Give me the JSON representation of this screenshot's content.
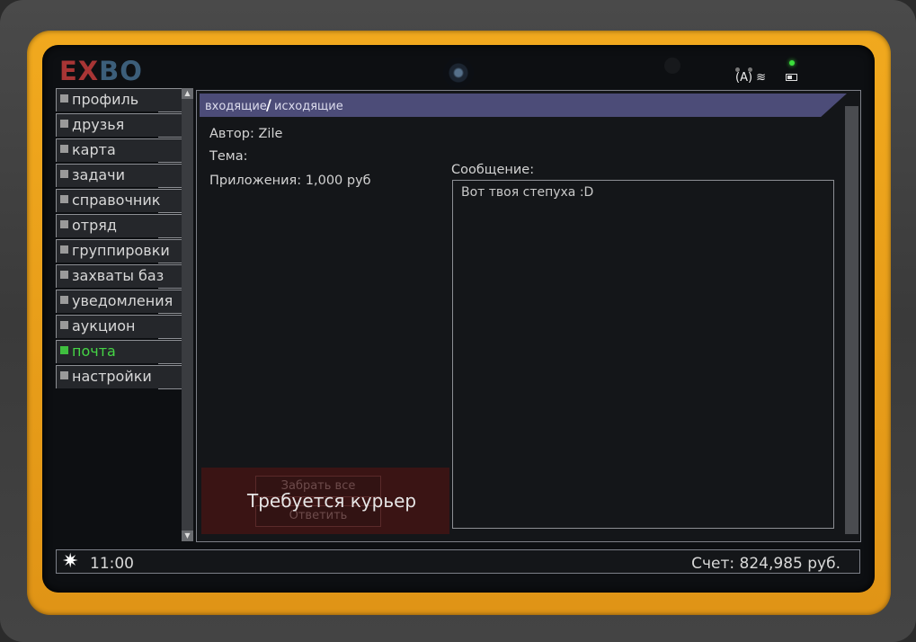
{
  "device": {
    "logo_part1": "EX",
    "logo_part2": "BO"
  },
  "nav": {
    "items": [
      {
        "label": "профиль",
        "active": false
      },
      {
        "label": "друзья",
        "active": false
      },
      {
        "label": "карта",
        "active": false
      },
      {
        "label": "задачи",
        "active": false
      },
      {
        "label": "справочник",
        "active": false
      },
      {
        "label": "отряд",
        "active": false
      },
      {
        "label": "группировки",
        "active": false
      },
      {
        "label": "захваты баз",
        "active": false
      },
      {
        "label": "уведомления",
        "active": false
      },
      {
        "label": "аукцион",
        "active": false
      },
      {
        "label": "почта",
        "active": true
      },
      {
        "label": "настройки",
        "active": false
      }
    ]
  },
  "mail": {
    "tab_incoming": "входящие",
    "tab_separator": "/",
    "tab_outgoing": "исходящие",
    "author": "Автор: Zile",
    "subject": "Тема:",
    "attachments": "Приложения: 1,000 руб",
    "message_label": "Сообщение:",
    "message_text": "Вот твоя степуха :D",
    "take_all_button": "Забрать все",
    "reply_button": "Ответить",
    "courier_notice": "Требуется курьер"
  },
  "status": {
    "time": "11:00",
    "account": "Счет: 824,985 руб."
  },
  "colors": {
    "accent_active": "#45d445",
    "tab_bg": "#4c4c78",
    "bezel": "#f1a91e"
  }
}
